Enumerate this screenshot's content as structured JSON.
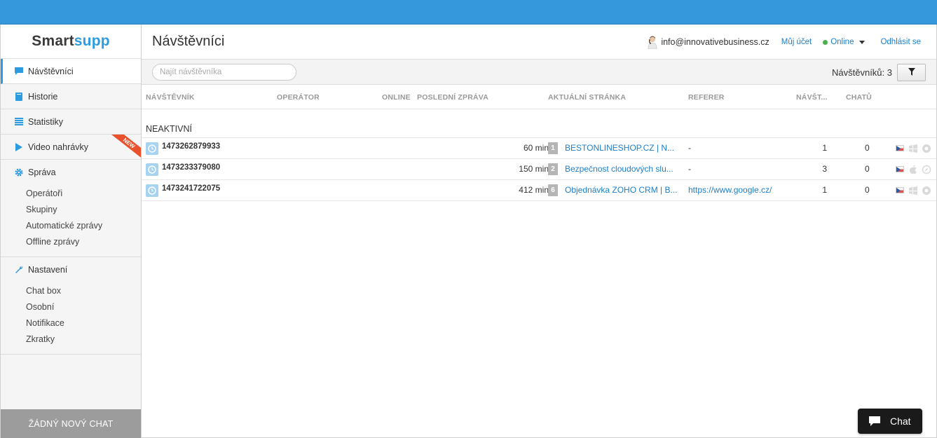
{
  "app": {
    "logo_part1": "Smart",
    "logo_part2": "supp",
    "accent_color": "#3597dc"
  },
  "sidebar": {
    "items": [
      {
        "label": "Návštěvníci",
        "icon": "chat-bubble-icon",
        "active": true
      },
      {
        "label": "Historie",
        "icon": "book-icon"
      },
      {
        "label": "Statistiky",
        "icon": "list-icon"
      },
      {
        "label": "Video nahrávky",
        "icon": "play-icon",
        "badge": "NEW"
      }
    ],
    "groups": [
      {
        "label": "Správa",
        "icon": "gear-icon",
        "subitems": [
          "Operátoři",
          "Skupiny",
          "Automatické zprávy",
          "Offline zprávy"
        ]
      },
      {
        "label": "Nastavení",
        "icon": "wrench-icon",
        "subitems": [
          "Chat box",
          "Osobní",
          "Notifikace",
          "Zkratky"
        ]
      }
    ],
    "footer": "ŽÁDNÝ NOVÝ CHAT"
  },
  "header": {
    "title": "Návštěvníci",
    "email": "info@innovativebusiness.cz",
    "account_link": "Můj účet",
    "status": "Online",
    "logout_link": "Odhlásit se"
  },
  "toolbar": {
    "search_placeholder": "Najít návštěvníka",
    "count_label": "Návštěvníků: 3"
  },
  "table": {
    "columns": [
      "NÁVŠTĚVNÍK",
      "OPERÁTOR",
      "ONLINE",
      "POSLEDNÍ ZPRÁVA",
      "AKTUÁLNÍ STRÁNKA",
      "REFERER",
      "NÁVŠT...",
      "CHATŮ"
    ],
    "section": "NEAKTIVNÍ",
    "rows": [
      {
        "visitor": "1473262879933",
        "online": "60 min",
        "page_num": "1",
        "page": "BESTONLINESHOP.CZ | N...",
        "referer": "-",
        "visits": "1",
        "chats": "0",
        "flag": "cz-flag-icon",
        "os": "windows-icon",
        "browser": "chrome-icon"
      },
      {
        "visitor": "1473233379080",
        "online": "150 min",
        "page_num": "2",
        "page": "Bezpečnost cloudových slu...",
        "referer": "-",
        "visits": "3",
        "chats": "0",
        "flag": "cz-flag-icon",
        "os": "apple-icon",
        "browser": "safari-icon"
      },
      {
        "visitor": "1473241722075",
        "online": "412 min",
        "page_num": "6",
        "page": "Objednávka ZOHO CRM | B...",
        "referer": "https://www.google.cz/",
        "visits": "1",
        "chats": "0",
        "flag": "cz-flag-icon",
        "os": "windows-icon",
        "browser": "chrome-icon"
      }
    ]
  },
  "chat_widget": {
    "label": "Chat"
  }
}
